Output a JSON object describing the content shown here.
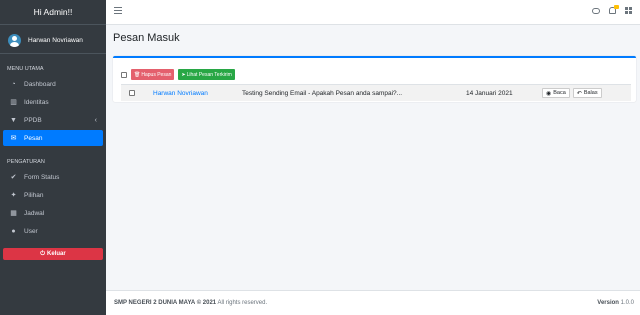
{
  "brand": {
    "title": "Hi Admin!!"
  },
  "user": {
    "name": "Harwan Novriawan"
  },
  "nav": {
    "header_main": "MENU UTAMA",
    "items_main": [
      {
        "label": "Dashboard",
        "icon": "dashboard-icon"
      },
      {
        "label": "Identitas",
        "icon": "institution-icon"
      },
      {
        "label": "PPDB",
        "icon": "filter-icon"
      },
      {
        "label": "Pesan",
        "icon": "envelope-icon"
      }
    ],
    "header_settings": "PENGATURAN",
    "items_settings": [
      {
        "label": "Form Status",
        "icon": "check-circle-icon"
      },
      {
        "label": "Pilihan",
        "icon": "magic-icon"
      },
      {
        "label": "Jadwal",
        "icon": "calendar-icon"
      },
      {
        "label": "User",
        "icon": "user-icon"
      }
    ],
    "logout_label": "Keluar"
  },
  "page": {
    "title": "Pesan Masuk"
  },
  "toolbar": {
    "delete_label": "Hapus Pesan",
    "sent_label": "Lihat Pesan Terkirim"
  },
  "messages": [
    {
      "sender": "Harwan Novriawan",
      "subject": "Testing Sending Email - Apakah Pesan anda sampai?...",
      "date": "14 Januari 2021",
      "read_label": "Baca",
      "reply_label": "Balas"
    }
  ],
  "footer": {
    "copyright": "SMP NEGERI 2 DUNIA MAYA © 2021",
    "rights": " All rights reserved.",
    "version_label": "Version",
    "version_value": " 1.0.0"
  },
  "colors": {
    "primary": "#007bff",
    "sidebar": "#343a40",
    "danger": "#dc3545",
    "success": "#28a745",
    "warning": "#ffc107"
  }
}
